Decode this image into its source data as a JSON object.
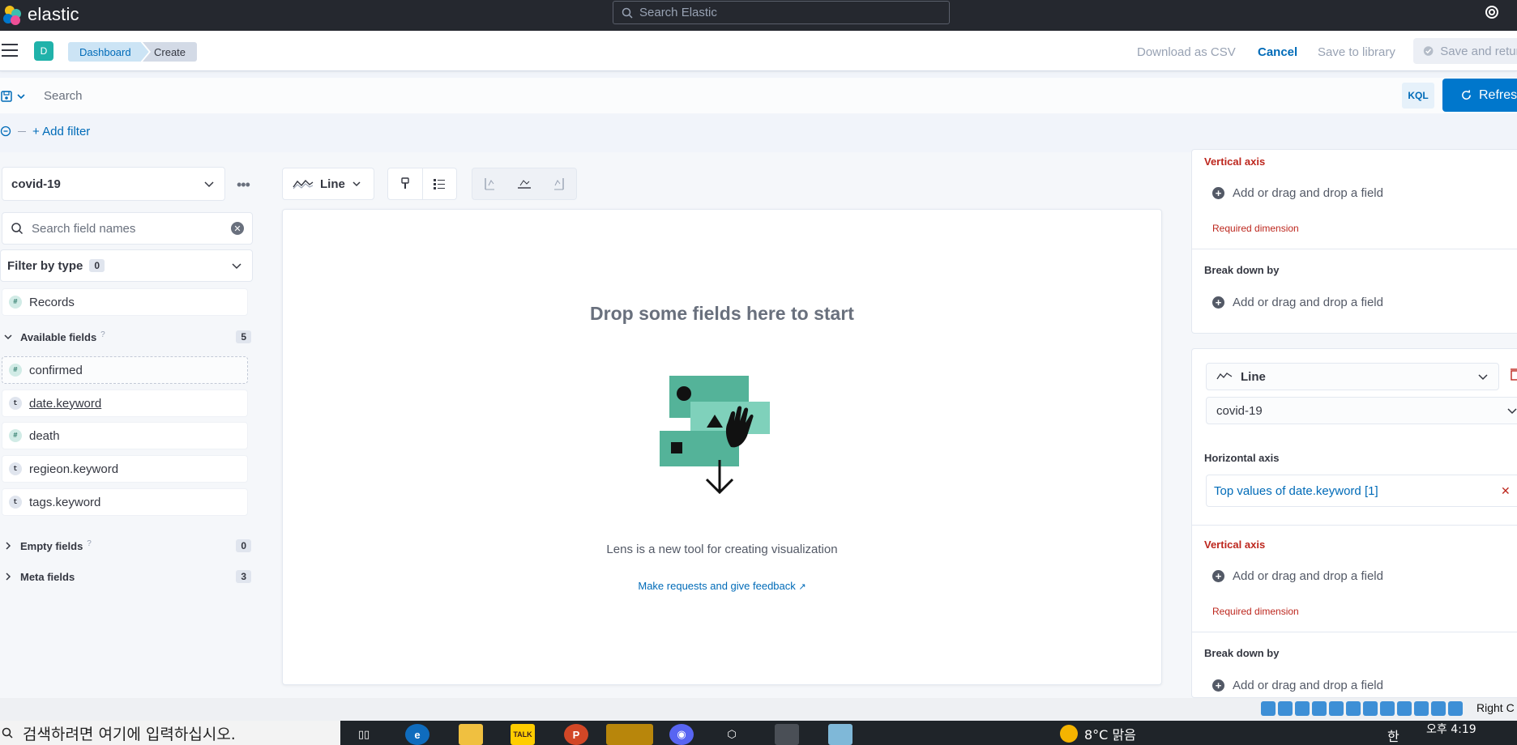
{
  "app": {
    "brand": "elastic",
    "global_search_placeholder": "Search Elastic"
  },
  "header": {
    "space_initial": "D",
    "breadcrumbs": [
      "Dashboard",
      "Create"
    ],
    "download_csv": "Download as CSV",
    "cancel": "Cancel",
    "save_to_library": "Save to library",
    "save_and_return": "Save and return"
  },
  "query": {
    "placeholder": "Search",
    "language": "KQL",
    "refresh": "Refresh",
    "add_filter": "+ Add filter"
  },
  "sidebar": {
    "index_pattern": "covid-19",
    "field_search_placeholder": "Search field names",
    "filter_by_type": "Filter by type",
    "filter_count": "0",
    "records": "Records",
    "available_fields_label": "Available fields",
    "available_fields_count": "5",
    "available_fields": [
      {
        "name": "confirmed",
        "type": "#"
      },
      {
        "name": "date.keyword",
        "type": "t"
      },
      {
        "name": "death",
        "type": "#"
      },
      {
        "name": "regieon.keyword",
        "type": "t"
      },
      {
        "name": "tags.keyword",
        "type": "t"
      }
    ],
    "empty_fields_label": "Empty fields",
    "empty_fields_count": "0",
    "meta_fields_label": "Meta fields",
    "meta_fields_count": "3"
  },
  "toolbar": {
    "chart_type": "Line"
  },
  "workspace": {
    "title": "Drop some fields here to start",
    "description": "Lens is a new tool for creating visualization",
    "feedback_link": "Make requests and give feedback"
  },
  "config": {
    "layer1": {
      "vertical_axis": "Vertical axis",
      "add_field": "Add or drag and drop a field",
      "required": "Required dimension",
      "break_down_by": "Break down by",
      "break_down_add": "Add or drag and drop a field"
    },
    "layer2": {
      "chart_type": "Line",
      "index_pattern": "covid-19",
      "horizontal_axis": "Horizontal axis",
      "horizontal_value": "Top values of date.keyword [1]",
      "vertical_axis": "Vertical axis",
      "add_field": "Add or drag and drop a field",
      "required": "Required dimension",
      "break_down_by": "Break down by",
      "break_down_add": "Add or drag and drop a field"
    }
  },
  "taskbar": {
    "search_placeholder": "검색하려면 여기에 입력하십시오.",
    "weather": "8°C 맑음",
    "time": "오후 4:19",
    "ime": "한",
    "right_ctrl": "Right C"
  },
  "colors": {
    "accent": "#0077cc",
    "danger": "#bd271e",
    "header_dark": "#25282f"
  }
}
